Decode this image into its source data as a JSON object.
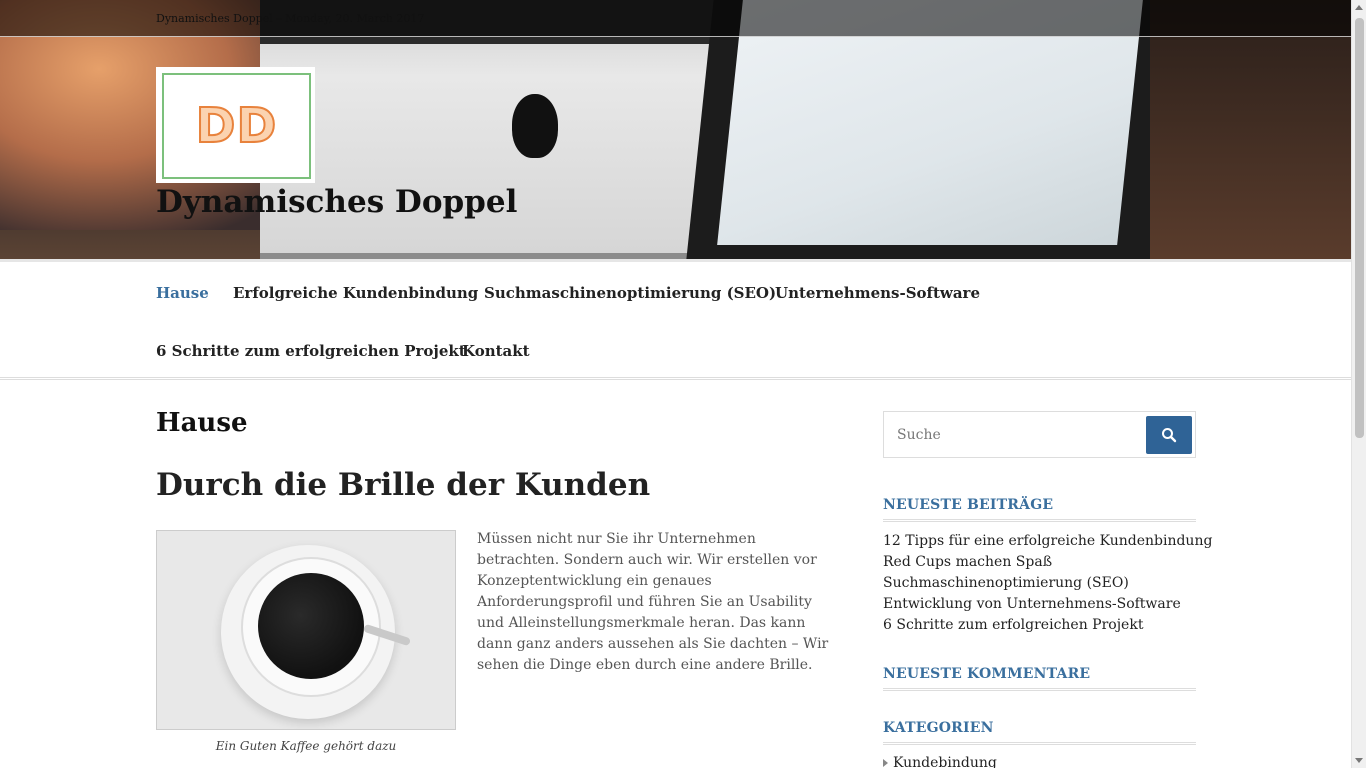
{
  "topbar": {
    "text": "Dynamisches Doppel – Monday, 20. March 2017"
  },
  "header": {
    "logo_text": "DD",
    "site_title": "Dynamisches Doppel"
  },
  "nav": {
    "items": [
      {
        "label": "Hause",
        "active": true
      },
      {
        "label": "Erfolgreiche Kundenbindung"
      },
      {
        "label": "Suchmaschinenoptimierung (SEO)"
      },
      {
        "label": "Unternehmens-Software"
      },
      {
        "label": "6 Schritte zum erfolgreichen Projekt"
      },
      {
        "label": "Kontakt"
      }
    ]
  },
  "main": {
    "page_title": "Hause",
    "post_title": "Durch die Brille der Kunden",
    "image_caption": "Ein Guten Kaffee gehört dazu",
    "body": "Müssen nicht nur Sie ihr Unternehmen betrachten. Sondern auch wir. Wir erstellen vor Konzeptentwicklung ein genaues Anforderungsprofil und führen Sie an Usability und Alleinstellungsmerkmale heran. Das kann dann ganz anders aussehen als Sie dachten – Wir sehen die Dinge eben durch eine andere Brille."
  },
  "sidebar": {
    "search": {
      "placeholder": "Suche"
    },
    "recent_posts": {
      "title": "NEUESTE BEITRÄGE",
      "items": [
        "12 Tipps für eine erfolgreiche Kundenbindung",
        "Red Cups machen Spaß",
        "Suchmaschinenoptimierung (SEO)",
        "Entwicklung von Unternehmens-Software",
        "6 Schritte zum erfolgreichen Projekt"
      ]
    },
    "recent_comments": {
      "title": "NEUESTE KOMMENTARE"
    },
    "categories": {
      "title": "KATEGORIEN",
      "items": [
        "Kundebindung"
      ]
    }
  },
  "colors": {
    "accent": "#3a6f9e",
    "button": "#2f6396",
    "text": "#222222"
  },
  "icons": {
    "search": "search-icon"
  }
}
